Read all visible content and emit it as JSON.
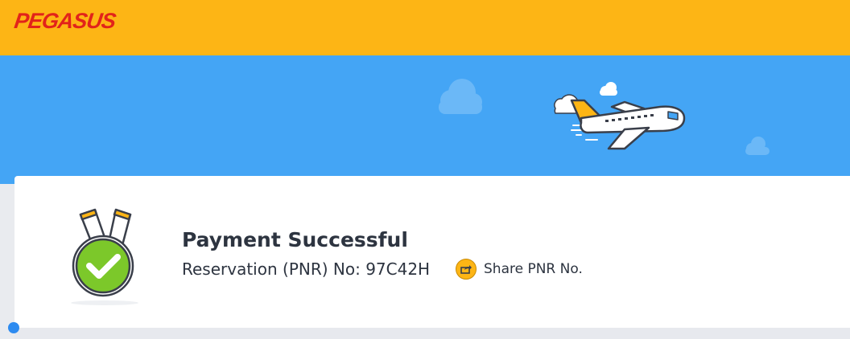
{
  "header": {
    "logo_text": "PEGASUS"
  },
  "confirmation": {
    "title": "Payment Successful",
    "pnr_label": "Reservation (PNR) No:",
    "pnr_value": "97C42H",
    "share_label": "Share PNR No."
  },
  "colors": {
    "header_yellow": "#fdb515",
    "hero_blue": "#44a5f5",
    "logo_red": "#e2231a",
    "success_green": "#7cc82a"
  },
  "icons": {
    "hero": "airplane-icon",
    "success": "success-medal-icon",
    "share": "share-icon"
  }
}
